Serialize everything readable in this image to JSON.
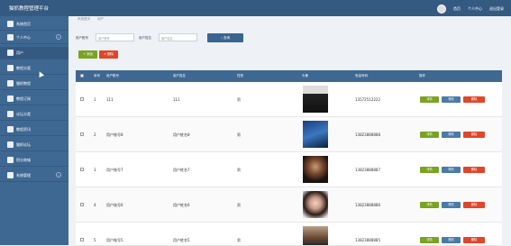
{
  "app": {
    "title": "猫抓教程管理平台"
  },
  "header": {
    "nav": [
      "首页",
      "个人中心",
      "退出登录"
    ]
  },
  "sidebar": {
    "items": [
      {
        "label": "系统首页",
        "icon": "home-icon"
      },
      {
        "label": "个人中心",
        "icon": "user-card-icon"
      },
      {
        "label": "用户",
        "icon": "flag-icon"
      },
      {
        "label": "教程分类",
        "icon": "comment-icon"
      },
      {
        "label": "猫抓教程",
        "icon": "book-icon"
      },
      {
        "label": "教程订阅",
        "icon": "comment-icon"
      },
      {
        "label": "论坛分类",
        "icon": "flag-icon"
      },
      {
        "label": "教程资讯",
        "icon": "flag-icon"
      },
      {
        "label": "猫抓论坛",
        "icon": "book-icon"
      },
      {
        "label": "积分商城",
        "icon": "coin-icon"
      },
      {
        "label": "系统管理",
        "icon": "settings-icon"
      }
    ]
  },
  "breadcrumb": [
    "系统首页",
    "用户"
  ],
  "search": {
    "field1_label": "用户账号",
    "field1_placeholder": "用户账号",
    "field2_label": "用户姓名",
    "field2_placeholder": "用户姓名",
    "button": "查询"
  },
  "toolbar": {
    "add": "添加",
    "delete": "删除"
  },
  "table": {
    "headers": [
      "",
      "序号",
      "用户账号",
      "用户姓名",
      "性别",
      "头像",
      "电话号码",
      "操作"
    ],
    "rows": [
      {
        "index": "1",
        "account": "111",
        "name": "111",
        "gender": "男",
        "phone": "13572512222"
      },
      {
        "index": "2",
        "account": "用户账号8",
        "name": "用户姓名8",
        "gender": "男",
        "phone": "13823888888"
      },
      {
        "index": "3",
        "account": "用户账号7",
        "name": "用户姓名7",
        "gender": "男",
        "phone": "13823888887"
      },
      {
        "index": "4",
        "account": "用户账号6",
        "name": "用户姓名6",
        "gender": "男",
        "phone": "13823888886"
      },
      {
        "index": "5",
        "account": "用户账号5",
        "name": "用户姓名5",
        "gender": "男",
        "phone": "13823888885"
      }
    ],
    "actions": [
      "详情",
      "修改",
      "删除"
    ]
  }
}
